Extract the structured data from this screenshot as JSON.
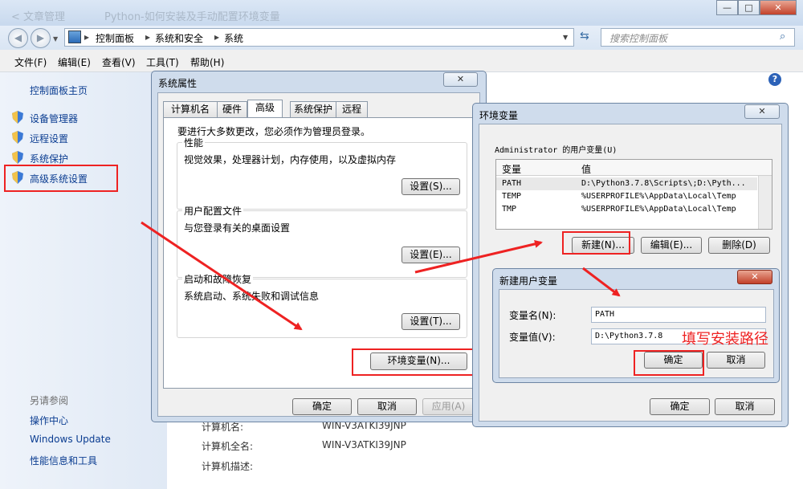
{
  "window": {
    "faint_title_1": "< 文章管理",
    "faint_title_2": "Python-如何安装及手动配置环境变量"
  },
  "caption_buttons": {
    "minimize": "—",
    "maximize": "□",
    "close": "✕"
  },
  "address": {
    "crumbs": [
      "控制面板",
      "系统和安全",
      "系统"
    ],
    "search_placeholder": "搜索控制面板"
  },
  "menu": [
    "文件(F)",
    "编辑(E)",
    "查看(V)",
    "工具(T)",
    "帮助(H)"
  ],
  "left_panel": {
    "home": "控制面板主页",
    "items": [
      "设备管理器",
      "远程设置",
      "系统保护",
      "高级系统设置"
    ],
    "see_also_title": "另请参阅",
    "see_also": [
      "操作中心",
      "Windows Update",
      "性能信息和工具"
    ]
  },
  "computer_info": {
    "rows": [
      {
        "label": "计算机名:",
        "value": "WIN-V3ATKI39JNP"
      },
      {
        "label": "计算机全名:",
        "value": "WIN-V3ATKI39JNP"
      },
      {
        "label": "计算机描述:",
        "value": ""
      }
    ]
  },
  "sys_props": {
    "title": "系统属性",
    "tabs": [
      "计算机名",
      "硬件",
      "高级",
      "系统保护",
      "远程"
    ],
    "admin_note": "要进行大多数更改，您必须作为管理员登录。",
    "performance": {
      "title": "性能",
      "desc": "视觉效果，处理器计划，内存使用，以及虚拟内存",
      "button": "设置(S)..."
    },
    "profiles": {
      "title": "用户配置文件",
      "desc": "与您登录有关的桌面设置",
      "button": "设置(E)..."
    },
    "startup": {
      "title": "启动和故障恢复",
      "desc": "系统启动、系统失败和调试信息",
      "button": "设置(T)..."
    },
    "env_button": "环境变量(N)...",
    "ok": "确定",
    "cancel": "取消",
    "apply": "应用(A)"
  },
  "env_vars": {
    "title": "环境变量",
    "user_section": "Administrator 的用户变量(U)",
    "col_var": "变量",
    "col_val": "值",
    "rows": [
      {
        "name": "PATH",
        "value": "D:\\Python3.7.8\\Scripts\\;D:\\Pyth..."
      },
      {
        "name": "TEMP",
        "value": "%USERPROFILE%\\AppData\\Local\\Temp"
      },
      {
        "name": "TMP",
        "value": "%USERPROFILE%\\AppData\\Local\\Temp"
      }
    ],
    "new_btn": "新建(N)...",
    "edit_btn": "编辑(E)...",
    "delete_btn": "删除(D)",
    "ok": "确定",
    "cancel": "取消"
  },
  "new_var": {
    "title": "新建用户变量",
    "name_label": "变量名(N):",
    "name_value": "PATH",
    "value_label": "变量值(V):",
    "value_value": "D:\\Python3.7.8",
    "ok": "确定",
    "cancel": "取消"
  },
  "annotation": {
    "text": "填写安装路径",
    "color": "#ee2222"
  },
  "colors": {
    "accent": "#0b3d91",
    "highlight": "#ee2222"
  }
}
